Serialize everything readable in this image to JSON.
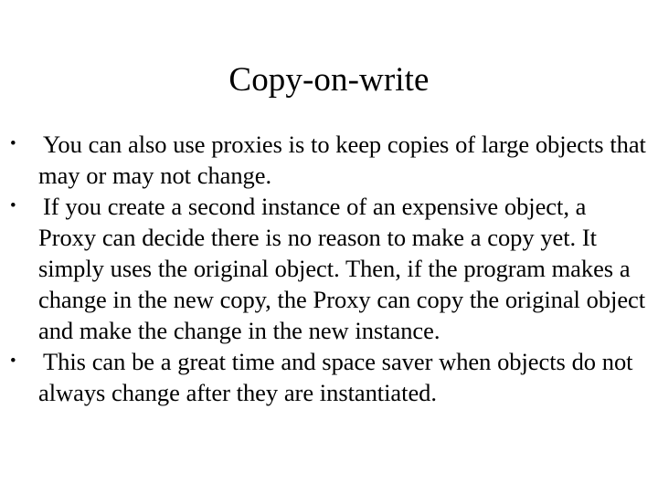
{
  "slide": {
    "title": "Copy-on-write",
    "background_color": "#ffffff",
    "text_color": "#000000",
    "bullet_glyph": "•",
    "bullets": [
      {
        "marker": "•",
        "text": "You can also use proxies is to keep copies of large objects that may or may not change."
      },
      {
        "marker": "•",
        "text": "If you create a second instance of an expensive object, a Proxy can decide there is no reason to make a copy yet. It simply uses the original object. Then, if the program makes a change in the new copy, the Proxy can copy the original object and make the change in the new instance."
      },
      {
        "marker": "•",
        "text": "This can be a great time and space saver when objects do not always change after they are instantiated."
      }
    ]
  }
}
